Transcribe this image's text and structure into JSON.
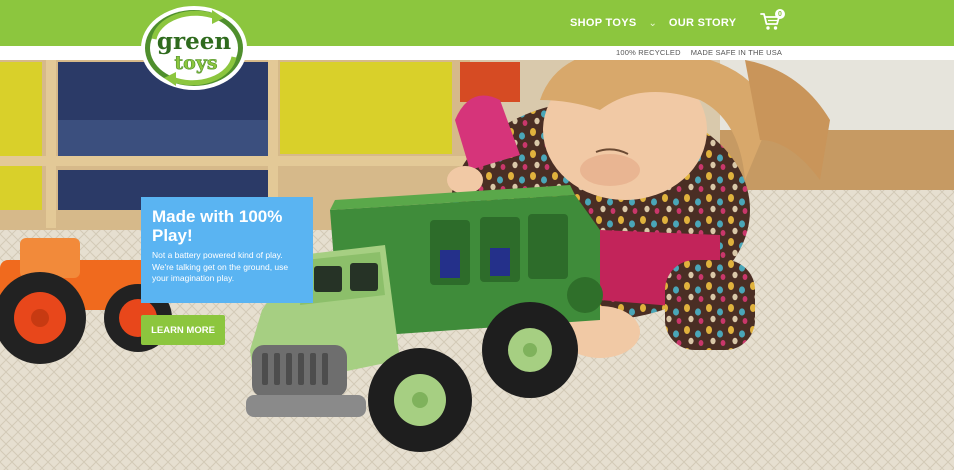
{
  "brand": {
    "logo_line1": "green",
    "logo_line2": "toys",
    "color_primary": "#8cc63e",
    "color_promo": "#5ab4f2"
  },
  "nav": {
    "items": [
      {
        "label": "SHOP TOYS",
        "icon": "chevron-down-icon"
      },
      {
        "label": "OUR STORY"
      }
    ],
    "cart_count": "0",
    "cart_icon": "shopping-cart-icon"
  },
  "subnav": {
    "links": [
      "100% RECYCLED",
      "MADE SAFE IN THE USA"
    ]
  },
  "hero": {
    "title": "Made with 100% Play!",
    "body": "Not a battery powered kind of play. We're talking get on the ground, use your imagination play.",
    "cta_label": "LEARN MORE"
  }
}
